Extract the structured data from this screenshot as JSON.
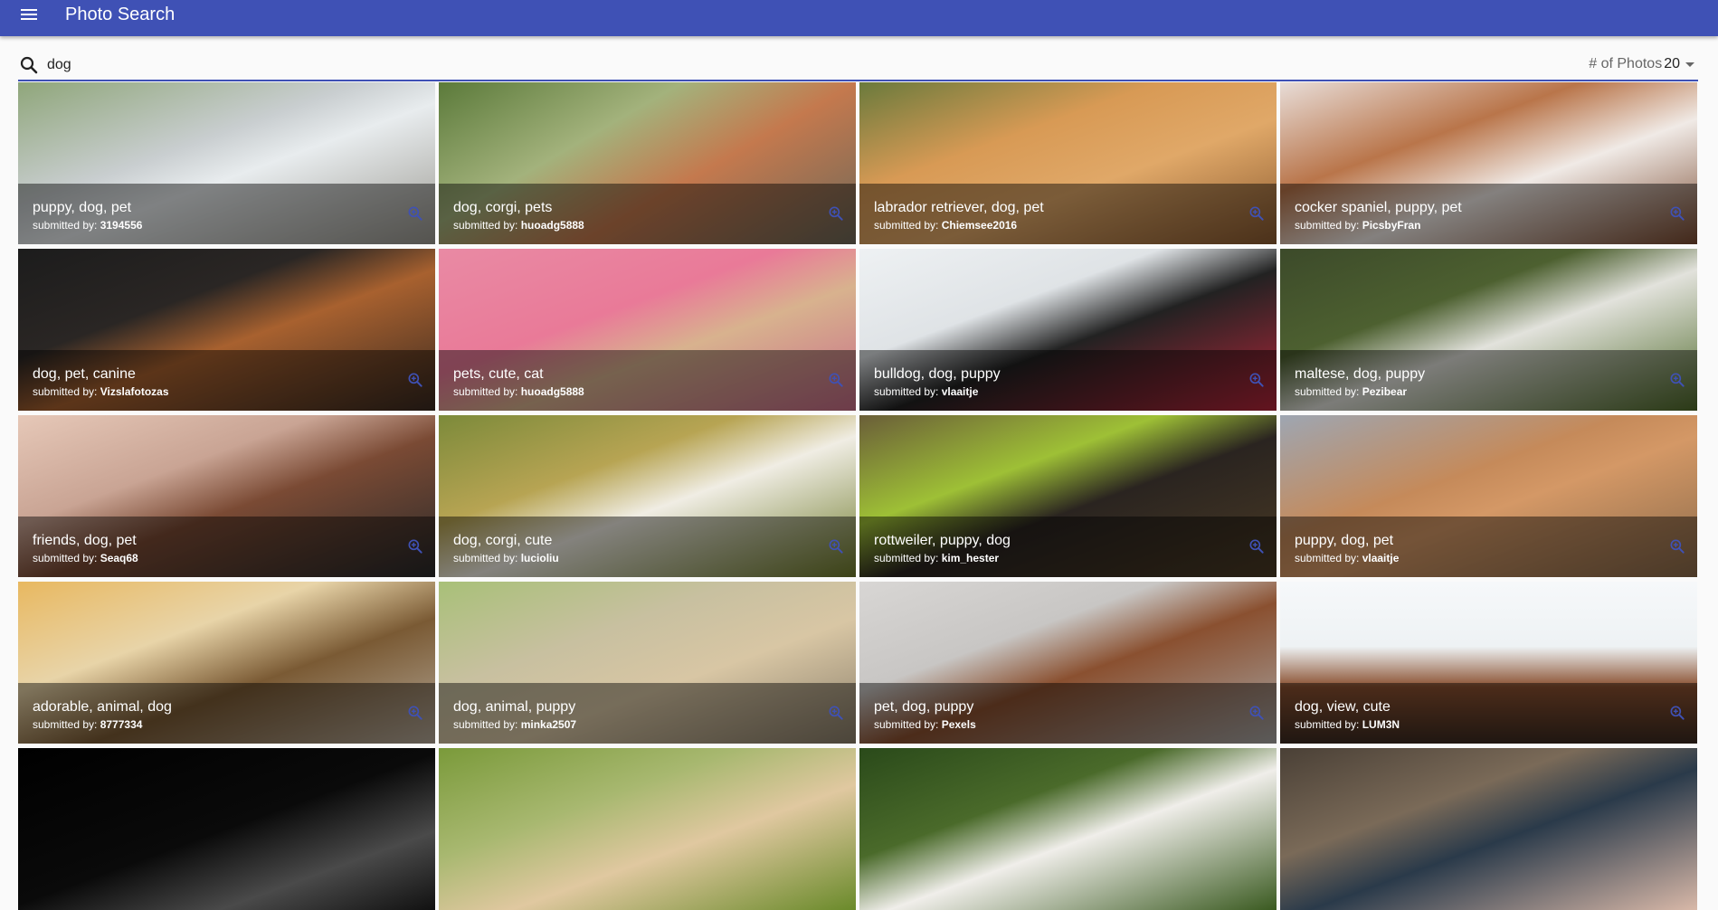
{
  "app": {
    "title": "Photo Search"
  },
  "search": {
    "value": "dog",
    "photos_label": "# of Photos",
    "photos_count": "20"
  },
  "submitted_prefix": "submitted by: ",
  "accent": "#3f51b5",
  "photos": [
    {
      "tags": "puppy, dog, pet",
      "user": "3194556",
      "bg": "linear-gradient(160deg,#8fa67a 0%,#c9ced0 40%,#e8ecee 55%,#9a9890 100%)"
    },
    {
      "tags": "dog, corgi, pets",
      "user": "huoadg5888",
      "bg": "linear-gradient(150deg,#5b7a3a 0%,#a3b27c 35%,#c4794e 60%,#6e6858 100%)"
    },
    {
      "tags": "labrador retriever, dog, pet",
      "user": "Chiemsee2016",
      "bg": "linear-gradient(160deg,#6a7a3c 0%,#d89a55 35%,#e0a868 60%,#8a5a30 100%)"
    },
    {
      "tags": "cocker spaniel, puppy, pet",
      "user": "PicsbyFran",
      "bg": "linear-gradient(160deg,#e8ddd8 0%,#b9754a 35%,#f0eae6 60%,#7a4a30 100%)"
    },
    {
      "tags": "dog, pet, canine",
      "user": "Vizslafotozas",
      "bg": "linear-gradient(160deg,#1c1c1c 0%,#2a2624 35%,#a8612f 55%,#3a2a20 100%)"
    },
    {
      "tags": "pets, cute, cat",
      "user": "huoadg5888",
      "bg": "linear-gradient(160deg,#e98aa4 0%,#e97a98 40%,#d8b28e 60%,#c76d88 100%)"
    },
    {
      "tags": "bulldog, dog, puppy",
      "user": "vlaaitje",
      "bg": "linear-gradient(160deg,#eef1f3 0%,#dfe3e6 35%,#222222 55%,#b5263a 100%)"
    },
    {
      "tags": "maltese, dog, puppy",
      "user": "Pezibear",
      "bg": "linear-gradient(160deg,#3c4a2a 0%,#4d6030 35%,#e2e2dc 55%,#4f6a2a 100%)"
    },
    {
      "tags": "friends, dog, pet",
      "user": "Seaq68",
      "bg": "linear-gradient(160deg,#e6c8b8 0%,#c9a494 35%,#7a4a34 55%,#2a2a2a 100%)"
    },
    {
      "tags": "dog, corgi, cute",
      "user": "lucioliu",
      "bg": "linear-gradient(160deg,#7c8a3a 0%,#b7a453 35%,#f0ede4 55%,#6e7a2a 100%)"
    },
    {
      "tags": "rottweiler, puppy, dog",
      "user": "kim_hester",
      "bg": "linear-gradient(160deg,#6a5e38 0%,#9ec036 35%,#2a2420 55%,#4a3a24 100%)"
    },
    {
      "tags": "puppy, dog, pet",
      "user": "vlaaitje",
      "bg": "linear-gradient(160deg,#9ea6b2 0%,#c58a5a 40%,#d49866 55%,#8a6a4a 100%)"
    },
    {
      "tags": "adorable, animal, dog",
      "user": "8777334",
      "bg": "linear-gradient(160deg,#e8b860 0%,#e8d4a8 35%,#7a5a34 60%,#b4a898 100%)"
    },
    {
      "tags": "dog, animal, puppy",
      "user": "minka2507",
      "bg": "linear-gradient(160deg,#a8c078 0%,#c8c0a0 35%,#d8c6a4 60%,#8a7e6a 100%)"
    },
    {
      "tags": "pet, dog, puppy",
      "user": "Pexels",
      "bg": "linear-gradient(160deg,#d8d6d4 0%,#c8c6c4 35%,#8a5030 55%,#a8a6a4 100%)"
    },
    {
      "tags": "dog, view, cute",
      "user": "LUM3N",
      "bg": "linear-gradient(180deg,#f6f8fa 0%,#eef2f4 40%,#8a5030 65%,#3a2a20 100%)"
    },
    {
      "tags": "",
      "user": "",
      "bg": "linear-gradient(160deg,#000000 0%,#0a0a0a 50%,#4a4a4a 75%,#111111 100%)"
    },
    {
      "tags": "",
      "user": "",
      "bg": "linear-gradient(160deg,#7a9a3a 0%,#a8b870 35%,#e0c8a0 60%,#6a8a2a 100%)"
    },
    {
      "tags": "",
      "user": "",
      "bg": "linear-gradient(160deg,#2a4a1a 0%,#4a6a2a 35%,#f0eeea 55%,#3a5a20 100%)"
    },
    {
      "tags": "",
      "user": "",
      "bg": "linear-gradient(160deg,#4a4036 0%,#7a6a58 35%,#2a3a4a 55%,#d8b8a8 100%)"
    }
  ]
}
